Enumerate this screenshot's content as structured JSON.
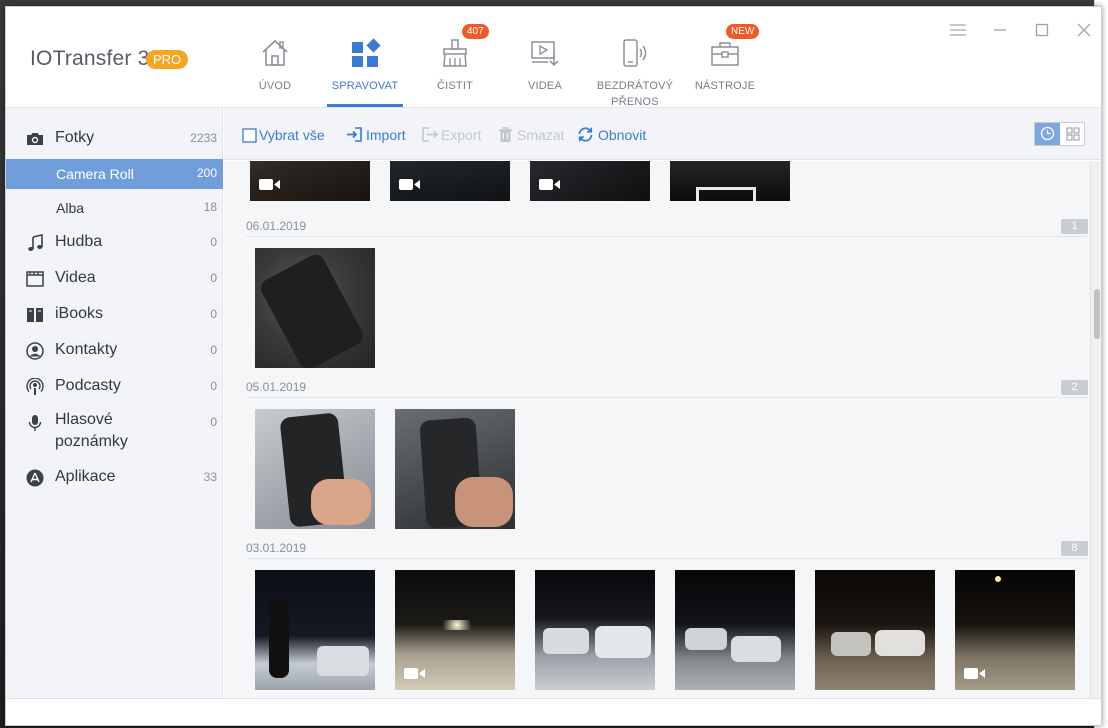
{
  "app": {
    "title": "IOTransfer 3",
    "badge": "PRO"
  },
  "nav": [
    {
      "label": "ÚVOD",
      "icon": "home-icon"
    },
    {
      "label": "SPRAVOVAT",
      "icon": "manage-icon",
      "active": true
    },
    {
      "label": "ČISTIT",
      "icon": "clean-icon",
      "badge": "407"
    },
    {
      "label": "VIDEA",
      "icon": "video-download-icon"
    },
    {
      "label": "BEZDRÁTOVÝ",
      "label2": "PŘENOS",
      "icon": "wireless-icon"
    },
    {
      "label": "NÁSTROJE",
      "icon": "toolbox-icon",
      "badge": "NEW"
    }
  ],
  "sidebar": {
    "items": [
      {
        "label": "Fotky",
        "count": "2233",
        "icon": "camera-icon"
      },
      {
        "label": "Camera Roll",
        "count": "200",
        "sub": true,
        "active": true
      },
      {
        "label": "Alba",
        "count": "18",
        "sub": true
      },
      {
        "label": "Hudba",
        "count": "0",
        "icon": "music-icon"
      },
      {
        "label": "Videa",
        "count": "0",
        "icon": "film-icon"
      },
      {
        "label": "iBooks",
        "count": "0",
        "icon": "book-icon"
      },
      {
        "label": "Kontakty",
        "count": "0",
        "icon": "contact-icon"
      },
      {
        "label": "Podcasty",
        "count": "0",
        "icon": "podcast-icon"
      },
      {
        "label": "Hlasové",
        "label2": "poznámky",
        "count": "0",
        "icon": "microphone-icon"
      },
      {
        "label": "Aplikace",
        "count": "33",
        "icon": "app-store-icon"
      }
    ]
  },
  "toolbar": {
    "select_all": "Vybrat vše",
    "import": "Import",
    "export": "Export",
    "delete": "Smazat",
    "refresh": "Obnovit"
  },
  "groups": [
    {
      "date": "06.01.2019",
      "count": "1"
    },
    {
      "date": "05.01.2019",
      "count": "2"
    },
    {
      "date": "03.01.2019",
      "count": "8"
    }
  ],
  "colors": {
    "accent": "#3a7bd5",
    "badge": "#f05a28",
    "pro": "#f5a623",
    "active_row": "#6f9edb"
  }
}
